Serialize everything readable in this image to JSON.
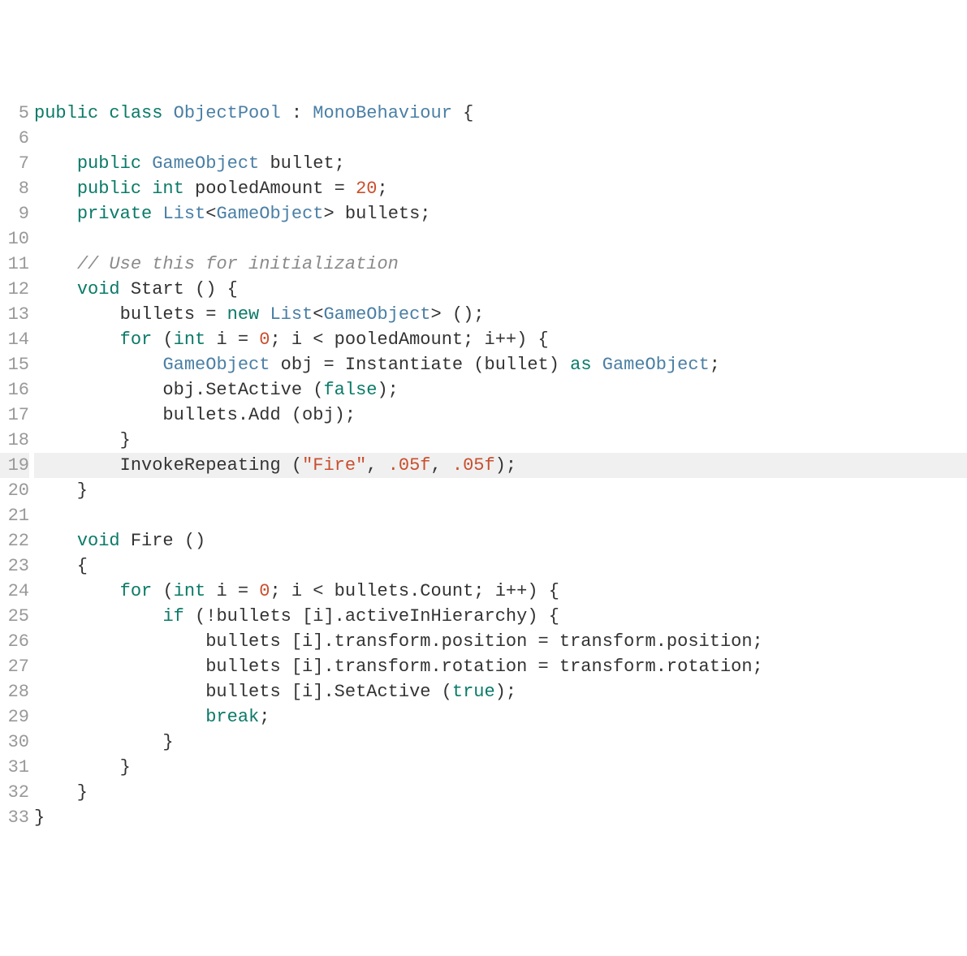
{
  "startLine": 5,
  "highlightedLine": 19,
  "lines": [
    [
      {
        "t": "public ",
        "c": "kw"
      },
      {
        "t": "class ",
        "c": "kw"
      },
      {
        "t": "ObjectPool ",
        "c": "cls"
      },
      {
        "t": ": ",
        "c": "op"
      },
      {
        "t": "MonoBehaviour ",
        "c": "cls"
      },
      {
        "t": "{",
        "c": "op"
      }
    ],
    [],
    [
      {
        "t": "    ",
        "c": ""
      },
      {
        "t": "public ",
        "c": "kw"
      },
      {
        "t": "GameObject ",
        "c": "cls"
      },
      {
        "t": "bullet;",
        "c": "op"
      }
    ],
    [
      {
        "t": "    ",
        "c": ""
      },
      {
        "t": "public ",
        "c": "kw"
      },
      {
        "t": "int ",
        "c": "kw"
      },
      {
        "t": "pooledAmount = ",
        "c": "op"
      },
      {
        "t": "20",
        "c": "numlit"
      },
      {
        "t": ";",
        "c": "op"
      }
    ],
    [
      {
        "t": "    ",
        "c": ""
      },
      {
        "t": "private ",
        "c": "kw"
      },
      {
        "t": "List",
        "c": "cls"
      },
      {
        "t": "<",
        "c": "op"
      },
      {
        "t": "GameObject",
        "c": "cls"
      },
      {
        "t": "> bullets;",
        "c": "op"
      }
    ],
    [],
    [
      {
        "t": "    ",
        "c": ""
      },
      {
        "t": "// Use this for initialization",
        "c": "cmt"
      }
    ],
    [
      {
        "t": "    ",
        "c": ""
      },
      {
        "t": "void ",
        "c": "kw"
      },
      {
        "t": "Start () {",
        "c": "op"
      }
    ],
    [
      {
        "t": "        bullets = ",
        "c": "op"
      },
      {
        "t": "new ",
        "c": "kw"
      },
      {
        "t": "List",
        "c": "cls"
      },
      {
        "t": "<",
        "c": "op"
      },
      {
        "t": "GameObject",
        "c": "cls"
      },
      {
        "t": "> ();",
        "c": "op"
      }
    ],
    [
      {
        "t": "        ",
        "c": ""
      },
      {
        "t": "for ",
        "c": "kw"
      },
      {
        "t": "(",
        "c": "op"
      },
      {
        "t": "int ",
        "c": "kw"
      },
      {
        "t": "i = ",
        "c": "op"
      },
      {
        "t": "0",
        "c": "numlit"
      },
      {
        "t": "; i < pooledAmount; i++) {",
        "c": "op"
      }
    ],
    [
      {
        "t": "            ",
        "c": ""
      },
      {
        "t": "GameObject ",
        "c": "cls"
      },
      {
        "t": "obj = Instantiate (bullet) ",
        "c": "op"
      },
      {
        "t": "as ",
        "c": "kw"
      },
      {
        "t": "GameObject",
        "c": "cls"
      },
      {
        "t": ";",
        "c": "op"
      }
    ],
    [
      {
        "t": "            obj.SetActive (",
        "c": "op"
      },
      {
        "t": "false",
        "c": "bool"
      },
      {
        "t": ");",
        "c": "op"
      }
    ],
    [
      {
        "t": "            bullets.Add (obj);",
        "c": "op"
      }
    ],
    [
      {
        "t": "        }",
        "c": "op"
      }
    ],
    [
      {
        "t": "        InvokeRepeating (",
        "c": "op"
      },
      {
        "t": "\"Fire\"",
        "c": "str"
      },
      {
        "t": ", ",
        "c": "op"
      },
      {
        "t": ".05f",
        "c": "numlit"
      },
      {
        "t": ", ",
        "c": "op"
      },
      {
        "t": ".05f",
        "c": "numlit"
      },
      {
        "t": ");",
        "c": "op"
      }
    ],
    [
      {
        "t": "    }",
        "c": "op"
      }
    ],
    [],
    [
      {
        "t": "    ",
        "c": ""
      },
      {
        "t": "void ",
        "c": "kw"
      },
      {
        "t": "Fire ()",
        "c": "op"
      }
    ],
    [
      {
        "t": "    {",
        "c": "op"
      }
    ],
    [
      {
        "t": "        ",
        "c": ""
      },
      {
        "t": "for ",
        "c": "kw"
      },
      {
        "t": "(",
        "c": "op"
      },
      {
        "t": "int ",
        "c": "kw"
      },
      {
        "t": "i = ",
        "c": "op"
      },
      {
        "t": "0",
        "c": "numlit"
      },
      {
        "t": "; i < bullets.Count; i++) {",
        "c": "op"
      }
    ],
    [
      {
        "t": "            ",
        "c": ""
      },
      {
        "t": "if ",
        "c": "kw"
      },
      {
        "t": "(!bullets [i].activeInHierarchy) {",
        "c": "op"
      }
    ],
    [
      {
        "t": "                bullets [i].transform.position = transform.position;",
        "c": "op"
      }
    ],
    [
      {
        "t": "                bullets [i].transform.rotation = transform.rotation;",
        "c": "op"
      }
    ],
    [
      {
        "t": "                bullets [i].SetActive (",
        "c": "op"
      },
      {
        "t": "true",
        "c": "bool"
      },
      {
        "t": ");",
        "c": "op"
      }
    ],
    [
      {
        "t": "                ",
        "c": ""
      },
      {
        "t": "break",
        "c": "kw"
      },
      {
        "t": ";",
        "c": "op"
      }
    ],
    [
      {
        "t": "            }",
        "c": "op"
      }
    ],
    [
      {
        "t": "        }",
        "c": "op"
      }
    ],
    [
      {
        "t": "    }",
        "c": "op"
      }
    ],
    [
      {
        "t": "}",
        "c": "op"
      }
    ]
  ]
}
